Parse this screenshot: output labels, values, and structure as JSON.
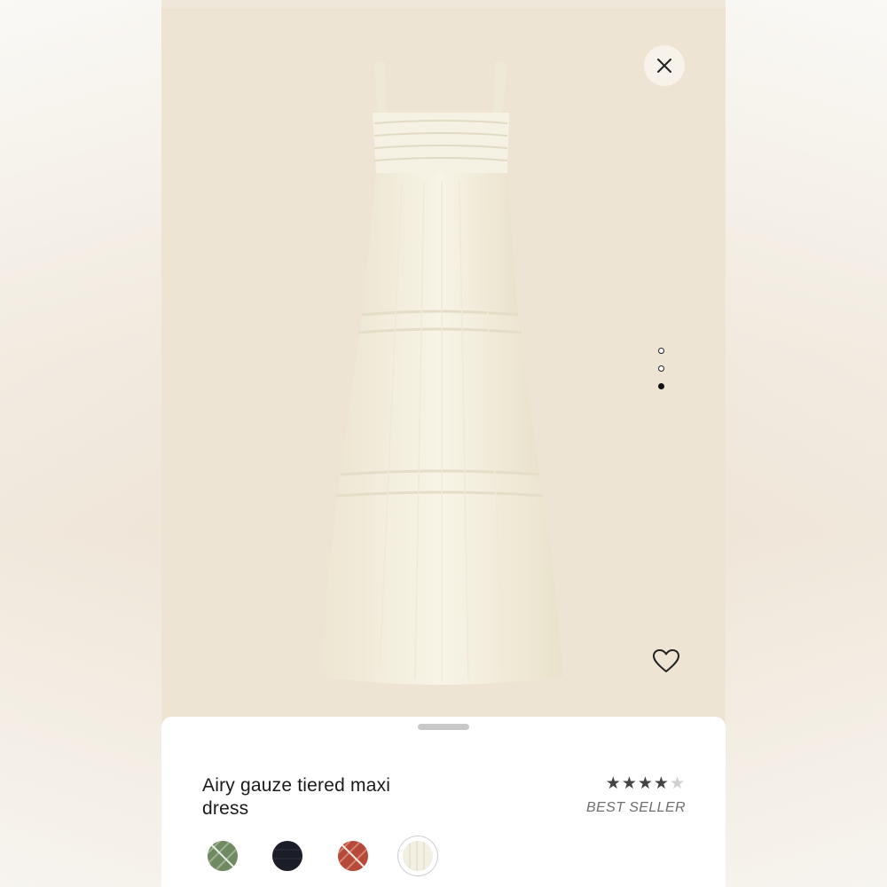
{
  "product": {
    "title": "Airy gauze tiered maxi dress",
    "rating": 4,
    "rating_max": 5,
    "badge": "BEST SELLER"
  },
  "gallery": {
    "current_index": 3,
    "total": 3,
    "background_color": "#eee4d4"
  },
  "actions": {
    "close_icon": "close-icon",
    "wishlist_icon": "heart-outline-icon"
  },
  "swatches": [
    {
      "name": "green-striped",
      "color": "#6f8a63",
      "selected": false
    },
    {
      "name": "black",
      "color": "#1b1d27",
      "selected": false
    },
    {
      "name": "red-striped",
      "color": "#b5493a",
      "selected": false
    },
    {
      "name": "ivory",
      "color": "#f3efe2",
      "selected": true
    }
  ]
}
